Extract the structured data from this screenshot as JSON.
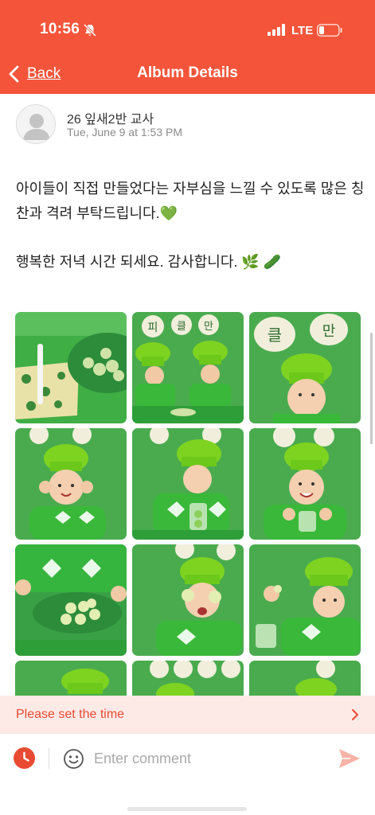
{
  "status_bar": {
    "time": "10:56",
    "network": "LTE"
  },
  "nav": {
    "back_label": "Back",
    "title": "Album Details"
  },
  "post": {
    "author": "26 잎새2반 교사",
    "date": "Tue, June 9 at 1:53 PM",
    "paragraphs": [
      "아이들이 직접 만들었다는 자부심을 느낄 수 있도록 많은 칭찬과 격려 부탁드립니다.💚",
      "행복한 저녁 시간 되세요. 감사합니다. 🌿 🥒"
    ]
  },
  "photo_sign_chars": {
    "photo2": [
      "피",
      "클",
      "만"
    ],
    "photo3": [
      "클",
      "만"
    ]
  },
  "time_bar": {
    "label": "Please set the time"
  },
  "comment": {
    "placeholder": "Enter comment"
  },
  "colors": {
    "accent": "#f4553a",
    "accent_dark": "#e94a33",
    "time_bar_bg": "#fdeae6",
    "green": "#3ba83b"
  },
  "icons": [
    "bell-off-icon",
    "signal-icon",
    "battery-icon",
    "back-chevron-icon",
    "clock-icon",
    "smile-icon",
    "send-icon",
    "chevron-right-icon"
  ]
}
